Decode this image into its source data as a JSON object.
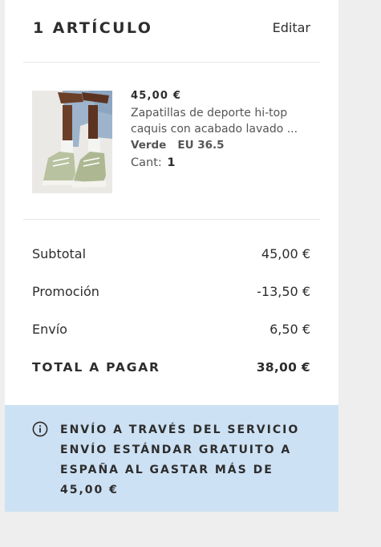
{
  "header": {
    "title": "1 ARTÍCULO",
    "edit_label": "Editar"
  },
  "item": {
    "price": "45,00 €",
    "name_line1": "Zapatillas de deporte hi-top",
    "name_line2": "caquis con acabado lavado ...",
    "color": "Verde",
    "size": "EU 36.5",
    "qty_label": "Cant:",
    "qty_value": "1"
  },
  "summary": {
    "subtotal_label": "Subtotal",
    "subtotal_value": "45,00 €",
    "promo_label": "Promoción",
    "promo_value": "-13,50 €",
    "shipping_label": "Envío",
    "shipping_value": "6,50 €",
    "total_label": "TOTAL A PAGAR",
    "total_value": "38,00 €"
  },
  "info": {
    "icon": "info-icon",
    "line1": "ENVÍO A TRAVÉS DEL SERVICIO",
    "line2": "ENVÍO ESTÁNDAR GRATUITO A",
    "line3": "ESPAÑA AL GASTAR MÁS DE",
    "line4": "45,00 €"
  },
  "colors": {
    "page_bg": "#eeeeee",
    "card_bg": "#ffffff",
    "info_bg": "#cde1f4",
    "text": "#2d2d2d"
  }
}
